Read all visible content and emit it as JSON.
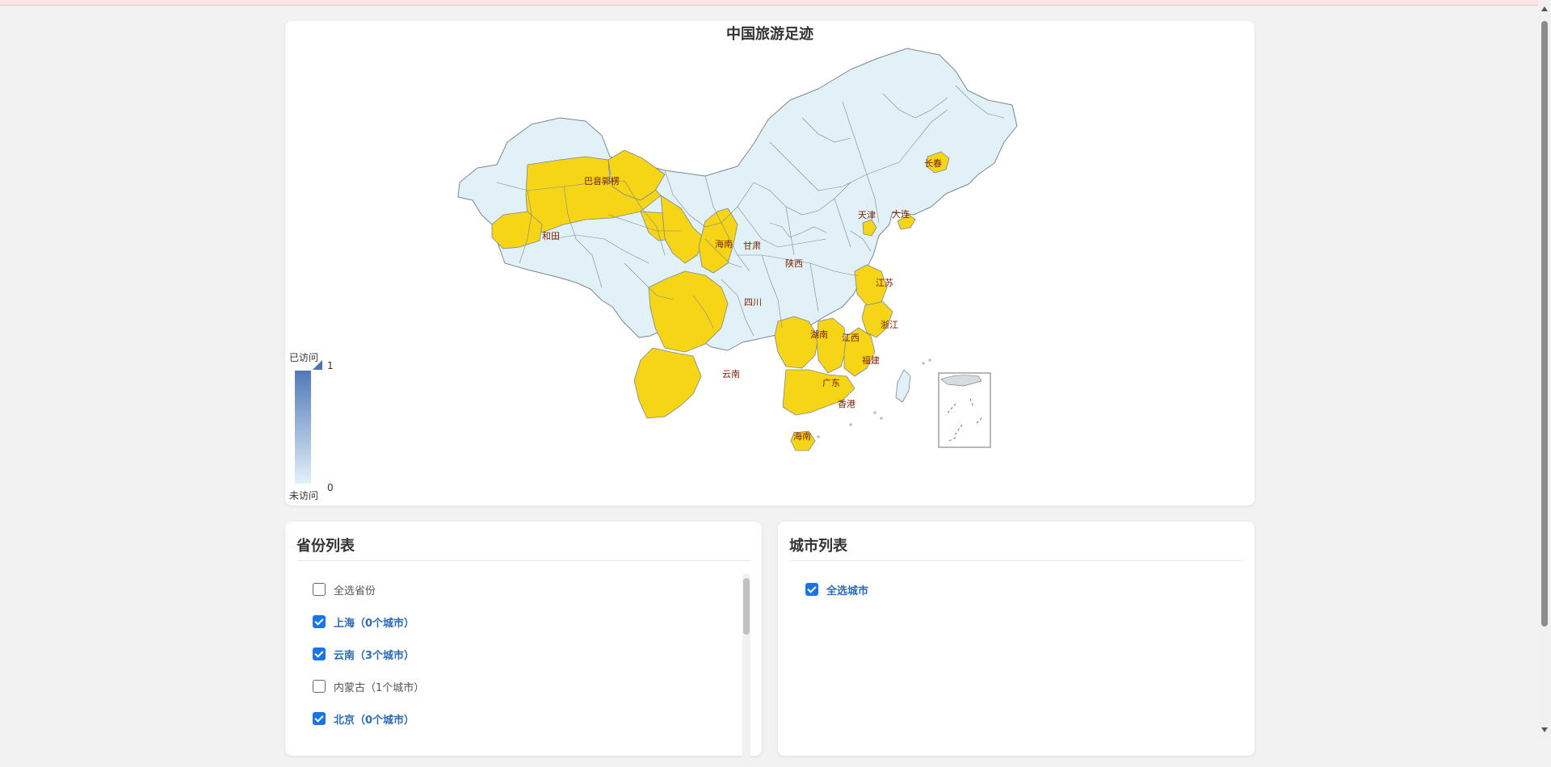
{
  "map": {
    "title": "中国旅游足迹",
    "colors": {
      "visited": "#f5d516",
      "unvisited": "#e2f1f7",
      "border": "#7b8791",
      "label": "#7a1f00"
    },
    "legend": {
      "top_label": "已访问",
      "bottom_label": "未访问",
      "max": "1",
      "min": "0"
    },
    "visited_labels": [
      "巴音郭楞",
      "和田",
      "海南",
      "甘肃",
      "陕西",
      "四川",
      "云南",
      "湖南",
      "江西",
      "福建",
      "浙江",
      "江苏",
      "广东",
      "香港",
      "海南",
      "天津",
      "大连",
      "长春"
    ]
  },
  "province_panel": {
    "title": "省份列表",
    "items": [
      {
        "label": "全选省份",
        "checked": false
      },
      {
        "label": "上海（0个城市）",
        "checked": true
      },
      {
        "label": "云南（3个城市）",
        "checked": true
      },
      {
        "label": "内蒙古（1个城市）",
        "checked": false
      },
      {
        "label": "北京（0个城市）",
        "checked": true
      }
    ]
  },
  "city_panel": {
    "title": "城市列表",
    "items": [
      {
        "label": "全选城市",
        "checked": true
      }
    ]
  }
}
